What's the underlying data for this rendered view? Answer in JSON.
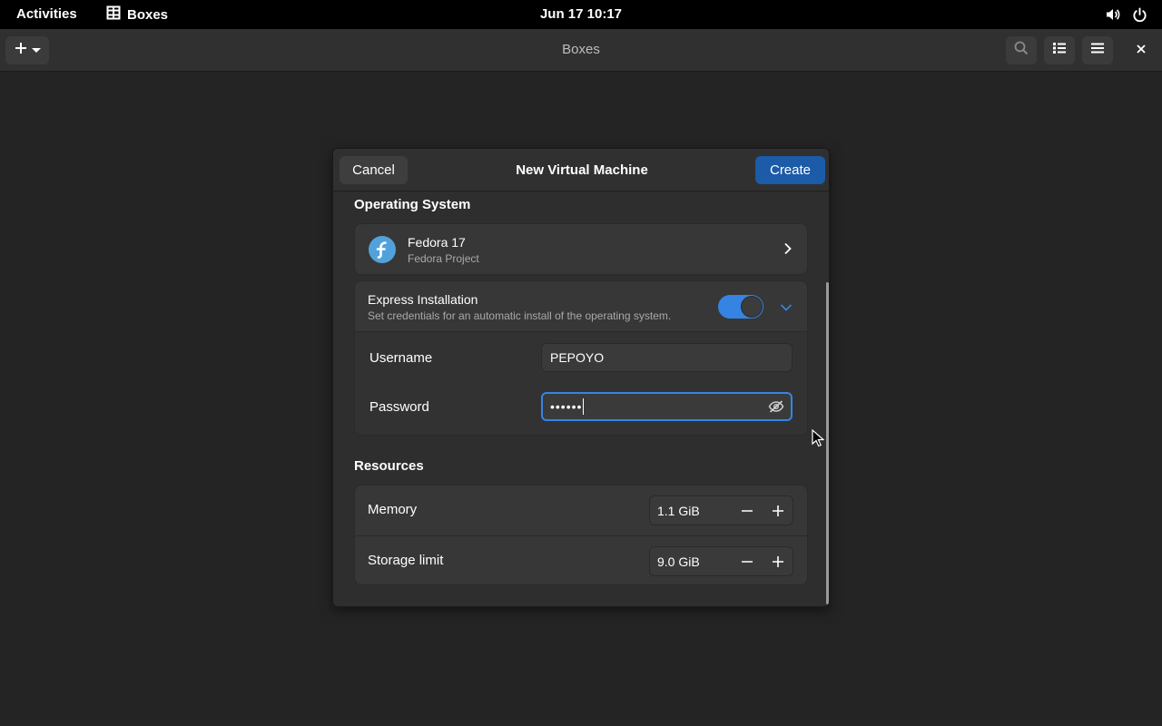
{
  "topbar": {
    "activities": "Activities",
    "app_name": "Boxes",
    "clock": "Jun 17  10:17",
    "icons": [
      "app-boxes-icon",
      "volume-icon",
      "power-icon"
    ]
  },
  "headerbar": {
    "title": "Boxes",
    "icons": [
      "plus-icon",
      "dropdown-arrow-icon",
      "search-icon",
      "list-view-icon",
      "hamburger-menu-icon",
      "close-icon"
    ]
  },
  "dialog": {
    "title": "New Virtual Machine",
    "cancel_label": "Cancel",
    "create_label": "Create",
    "os_section": {
      "title": "Operating System",
      "os_name": "Fedora 17",
      "os_vendor": "Fedora Project"
    },
    "express": {
      "title": "Express Installation",
      "subtitle": "Set credentials for an automatic install of the operating system.",
      "enabled": true,
      "username_label": "Username",
      "username_value": "PEPOYO",
      "password_label": "Password",
      "password_value": "••••••"
    },
    "resources": {
      "title": "Resources",
      "memory_label": "Memory",
      "memory_value": "1.1 GiB",
      "storage_label": "Storage limit",
      "storage_value": "9.0 GiB"
    }
  },
  "colors": {
    "accent": "#3584e4",
    "create_button": "#1c5ba8",
    "fedora_logo": "#51a2da"
  }
}
